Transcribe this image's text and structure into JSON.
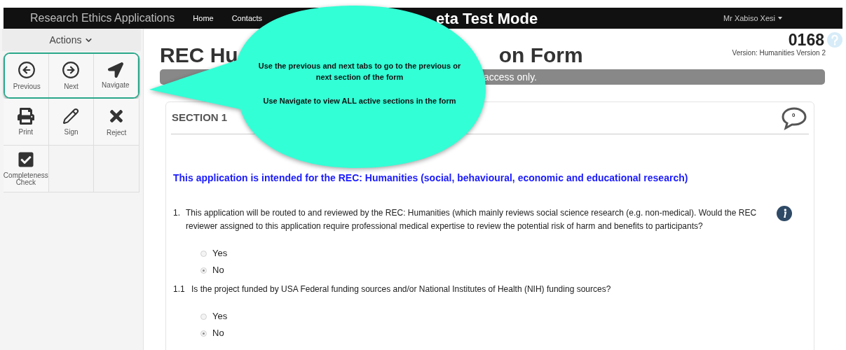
{
  "navbar": {
    "brand": "Research Ethics Applications",
    "links": [
      "Home",
      "Contacts"
    ],
    "mode_text": "eta Test Mode",
    "user": "Mr Xabiso Xesi"
  },
  "sidebar": {
    "header": "Actions",
    "rows": [
      {
        "highlighted": true,
        "items": [
          {
            "kind": "previous",
            "label": "Previous"
          },
          {
            "kind": "next",
            "label": "Next"
          },
          {
            "kind": "navigate",
            "label": "Navigate"
          }
        ]
      },
      {
        "highlighted": false,
        "items": [
          {
            "kind": "print",
            "label": "Print"
          },
          {
            "kind": "sign",
            "label": "Sign"
          },
          {
            "kind": "reject",
            "label": "Reject"
          }
        ]
      },
      {
        "highlighted": false,
        "items": [
          {
            "kind": "check",
            "label": "Completeness Check"
          }
        ]
      }
    ]
  },
  "callout": {
    "paragraphs": [
      "Use the previous and next tabs to go to the previous or next section of the form",
      "Use Navigate to view ALL active sections in the form"
    ]
  },
  "form": {
    "title_start": "REC Hu",
    "title_end": "on Form",
    "number": "0168",
    "version": "Version: Humanities Version 2",
    "banner_text": "access only.",
    "section": {
      "title": "SECTION 1",
      "comment_count": "0"
    },
    "intro": "This application is intended for the REC: Humanities (social, behavioural, economic and educational research)",
    "questions": [
      {
        "number": "1.",
        "text": "This application will be routed to and reviewed by the REC: Humanities (which mainly reviews social science research (e.g. non-medical). Would the REC reviewer assigned to this application require professional medical expertise to review the potential risk of harm and benefits to participants?",
        "info": true,
        "options": [
          {
            "label": "Yes",
            "selected": false
          },
          {
            "label": "No",
            "selected": true
          }
        ]
      },
      {
        "number": "1.1",
        "text": "Is the project funded by USA Federal funding sources and/or National Institutes of Health (NIH) funding sources?",
        "info": false,
        "options": [
          {
            "label": "Yes",
            "selected": false
          },
          {
            "label": "No",
            "selected": true
          }
        ]
      }
    ]
  }
}
